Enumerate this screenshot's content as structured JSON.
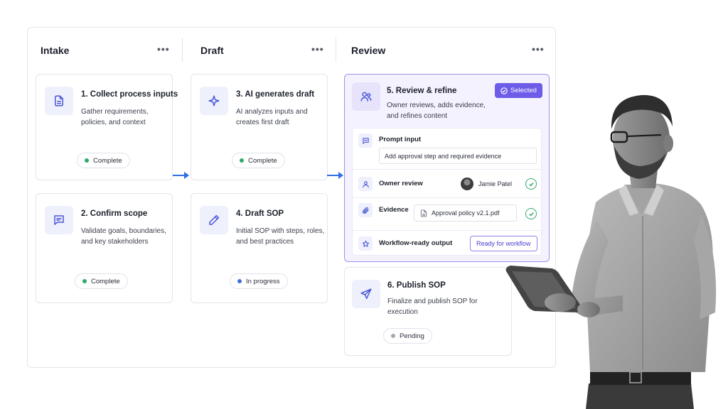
{
  "columns": [
    {
      "title": "Intake",
      "menu": "•••"
    },
    {
      "title": "Draft",
      "menu": "•••"
    },
    {
      "title": "Review",
      "menu": "•••"
    }
  ],
  "cards": {
    "c1": {
      "title": "1. Collect process inputs",
      "desc": "Gather requirements, policies, and context",
      "status": "Complete",
      "icon": "document-icon"
    },
    "c2": {
      "title": "2.  Confirm scope",
      "desc": "Validate goals, boundaries, and key stakeholders",
      "status": "Complete",
      "icon": "chat-icon"
    },
    "c3": {
      "title": "3. AI generates draft",
      "desc": "AI analyzes inputs and creates first draft",
      "status": "Complete",
      "icon": "sparkle-icon"
    },
    "c4": {
      "title": "4. Draft SOP",
      "desc": "Initial SOP with steps, roles, and best practices",
      "status": "In progress",
      "icon": "pencil-icon"
    },
    "c5": {
      "title": "5. Review & refine",
      "desc": "Owner reviews, adds evidence, and refines content",
      "badge": "Selected",
      "icon": "users-icon"
    },
    "c6": {
      "title": "6. Publish SOP",
      "desc": "Finalize and publish SOP for execution",
      "status": "Pending",
      "icon": "send-icon"
    }
  },
  "review": {
    "prompt_label": "Prompt input",
    "prompt_value": "Add approval step and required evidence",
    "owner_label": "Owner review",
    "owner_name": "Jamie Patel",
    "evidence_label": "Evidence",
    "evidence_file": "Approval policy v2.1.pdf",
    "output_label": "Workflow-ready output",
    "output_button": "Ready for workflow"
  },
  "colors": {
    "accent": "#6d5ce8",
    "complete": "#2fa86b",
    "in_progress": "#3b6fe0",
    "pending": "#a5a8b0",
    "arrow": "#2f6fe4"
  }
}
